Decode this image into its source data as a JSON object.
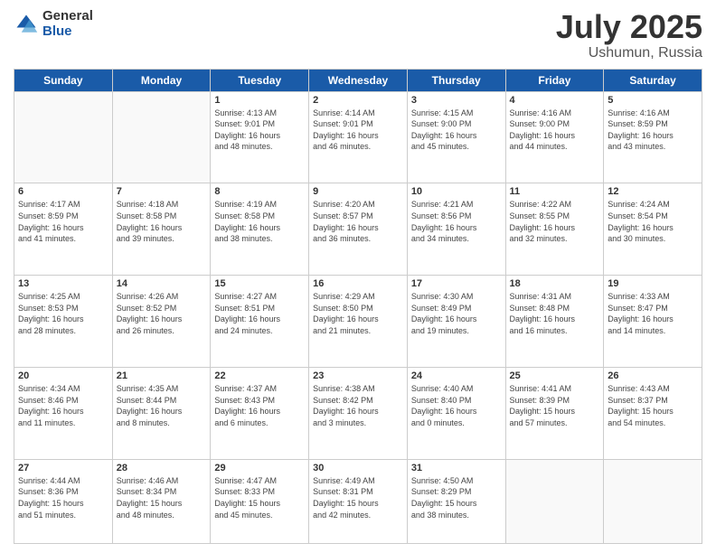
{
  "logo": {
    "general": "General",
    "blue": "Blue"
  },
  "title": "July 2025",
  "location": "Ushumun, Russia",
  "days_of_week": [
    "Sunday",
    "Monday",
    "Tuesday",
    "Wednesday",
    "Thursday",
    "Friday",
    "Saturday"
  ],
  "weeks": [
    [
      {
        "day": "",
        "info": ""
      },
      {
        "day": "",
        "info": ""
      },
      {
        "day": "1",
        "info": "Sunrise: 4:13 AM\nSunset: 9:01 PM\nDaylight: 16 hours\nand 48 minutes."
      },
      {
        "day": "2",
        "info": "Sunrise: 4:14 AM\nSunset: 9:01 PM\nDaylight: 16 hours\nand 46 minutes."
      },
      {
        "day": "3",
        "info": "Sunrise: 4:15 AM\nSunset: 9:00 PM\nDaylight: 16 hours\nand 45 minutes."
      },
      {
        "day": "4",
        "info": "Sunrise: 4:16 AM\nSunset: 9:00 PM\nDaylight: 16 hours\nand 44 minutes."
      },
      {
        "day": "5",
        "info": "Sunrise: 4:16 AM\nSunset: 8:59 PM\nDaylight: 16 hours\nand 43 minutes."
      }
    ],
    [
      {
        "day": "6",
        "info": "Sunrise: 4:17 AM\nSunset: 8:59 PM\nDaylight: 16 hours\nand 41 minutes."
      },
      {
        "day": "7",
        "info": "Sunrise: 4:18 AM\nSunset: 8:58 PM\nDaylight: 16 hours\nand 39 minutes."
      },
      {
        "day": "8",
        "info": "Sunrise: 4:19 AM\nSunset: 8:58 PM\nDaylight: 16 hours\nand 38 minutes."
      },
      {
        "day": "9",
        "info": "Sunrise: 4:20 AM\nSunset: 8:57 PM\nDaylight: 16 hours\nand 36 minutes."
      },
      {
        "day": "10",
        "info": "Sunrise: 4:21 AM\nSunset: 8:56 PM\nDaylight: 16 hours\nand 34 minutes."
      },
      {
        "day": "11",
        "info": "Sunrise: 4:22 AM\nSunset: 8:55 PM\nDaylight: 16 hours\nand 32 minutes."
      },
      {
        "day": "12",
        "info": "Sunrise: 4:24 AM\nSunset: 8:54 PM\nDaylight: 16 hours\nand 30 minutes."
      }
    ],
    [
      {
        "day": "13",
        "info": "Sunrise: 4:25 AM\nSunset: 8:53 PM\nDaylight: 16 hours\nand 28 minutes."
      },
      {
        "day": "14",
        "info": "Sunrise: 4:26 AM\nSunset: 8:52 PM\nDaylight: 16 hours\nand 26 minutes."
      },
      {
        "day": "15",
        "info": "Sunrise: 4:27 AM\nSunset: 8:51 PM\nDaylight: 16 hours\nand 24 minutes."
      },
      {
        "day": "16",
        "info": "Sunrise: 4:29 AM\nSunset: 8:50 PM\nDaylight: 16 hours\nand 21 minutes."
      },
      {
        "day": "17",
        "info": "Sunrise: 4:30 AM\nSunset: 8:49 PM\nDaylight: 16 hours\nand 19 minutes."
      },
      {
        "day": "18",
        "info": "Sunrise: 4:31 AM\nSunset: 8:48 PM\nDaylight: 16 hours\nand 16 minutes."
      },
      {
        "day": "19",
        "info": "Sunrise: 4:33 AM\nSunset: 8:47 PM\nDaylight: 16 hours\nand 14 minutes."
      }
    ],
    [
      {
        "day": "20",
        "info": "Sunrise: 4:34 AM\nSunset: 8:46 PM\nDaylight: 16 hours\nand 11 minutes."
      },
      {
        "day": "21",
        "info": "Sunrise: 4:35 AM\nSunset: 8:44 PM\nDaylight: 16 hours\nand 8 minutes."
      },
      {
        "day": "22",
        "info": "Sunrise: 4:37 AM\nSunset: 8:43 PM\nDaylight: 16 hours\nand 6 minutes."
      },
      {
        "day": "23",
        "info": "Sunrise: 4:38 AM\nSunset: 8:42 PM\nDaylight: 16 hours\nand 3 minutes."
      },
      {
        "day": "24",
        "info": "Sunrise: 4:40 AM\nSunset: 8:40 PM\nDaylight: 16 hours\nand 0 minutes."
      },
      {
        "day": "25",
        "info": "Sunrise: 4:41 AM\nSunset: 8:39 PM\nDaylight: 15 hours\nand 57 minutes."
      },
      {
        "day": "26",
        "info": "Sunrise: 4:43 AM\nSunset: 8:37 PM\nDaylight: 15 hours\nand 54 minutes."
      }
    ],
    [
      {
        "day": "27",
        "info": "Sunrise: 4:44 AM\nSunset: 8:36 PM\nDaylight: 15 hours\nand 51 minutes."
      },
      {
        "day": "28",
        "info": "Sunrise: 4:46 AM\nSunset: 8:34 PM\nDaylight: 15 hours\nand 48 minutes."
      },
      {
        "day": "29",
        "info": "Sunrise: 4:47 AM\nSunset: 8:33 PM\nDaylight: 15 hours\nand 45 minutes."
      },
      {
        "day": "30",
        "info": "Sunrise: 4:49 AM\nSunset: 8:31 PM\nDaylight: 15 hours\nand 42 minutes."
      },
      {
        "day": "31",
        "info": "Sunrise: 4:50 AM\nSunset: 8:29 PM\nDaylight: 15 hours\nand 38 minutes."
      },
      {
        "day": "",
        "info": ""
      },
      {
        "day": "",
        "info": ""
      }
    ]
  ]
}
